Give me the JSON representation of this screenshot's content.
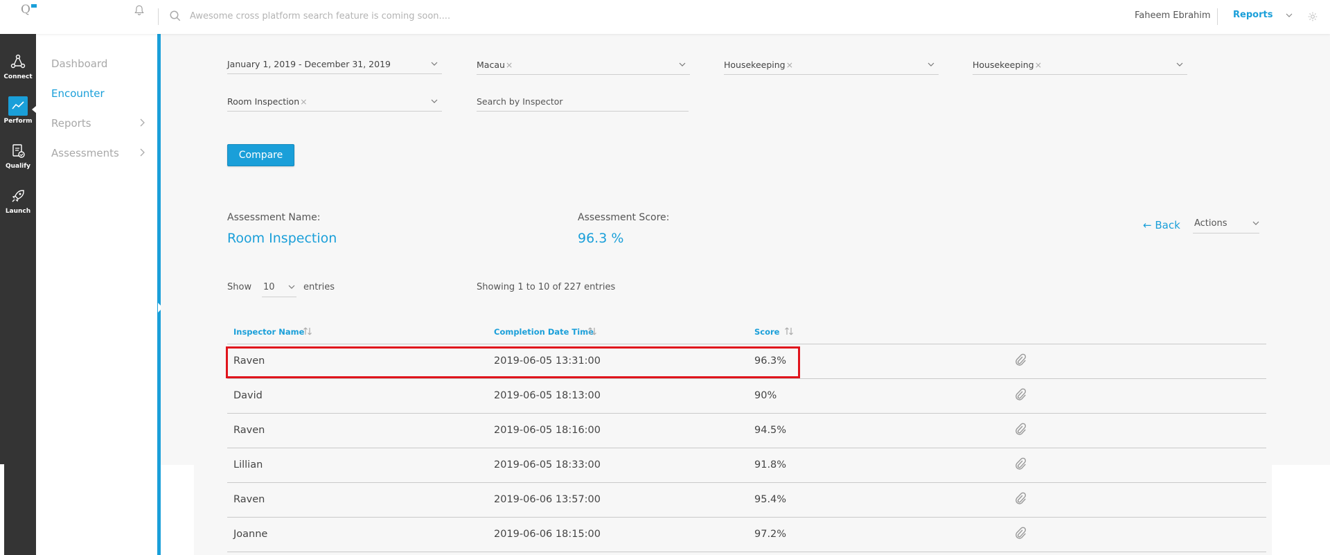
{
  "header": {
    "search_placeholder": "Awesome cross platform search feature is coming soon....",
    "user_name": "Faheem Ebrahim",
    "module_name": "Reports"
  },
  "rail": {
    "items": [
      {
        "label": "Connect",
        "icon": "connect-icon"
      },
      {
        "label": "Perform",
        "icon": "chart-line-icon",
        "active": true
      },
      {
        "label": "Qualify",
        "icon": "clipboard-check-icon"
      },
      {
        "label": "Launch",
        "icon": "rocket-icon"
      }
    ]
  },
  "subnav": {
    "items": [
      {
        "label": "Dashboard"
      },
      {
        "label": "Encounter",
        "active": true
      },
      {
        "label": "Reports"
      },
      {
        "label": "Assessments"
      }
    ]
  },
  "filters": {
    "date_range": "January 1, 2019 - December 31, 2019",
    "location": "Macau",
    "department_1": "Housekeeping",
    "department_2": "Housekeeping",
    "assessment": "Room Inspection",
    "inspector_placeholder": "Search by Inspector",
    "clear_symbol": "×"
  },
  "compare_button": "Compare",
  "summary": {
    "name_label": "Assessment Name:",
    "name_value": "Room Inspection",
    "score_label": "Assessment Score:",
    "score_value": "96.3 %",
    "back_label": "← Back",
    "actions_label": "Actions"
  },
  "table_controls": {
    "show_label": "Show",
    "page_length": "10",
    "entries_label": "entries",
    "info": "Showing 1 to 10 of 227 entries"
  },
  "table": {
    "columns": [
      "Inspector Name",
      "Completion Date Time",
      "Score"
    ],
    "rows": [
      {
        "name": "Raven",
        "datetime": "2019-06-05 13:31:00",
        "score": "96.3%"
      },
      {
        "name": "David",
        "datetime": "2019-06-05 18:13:00",
        "score": "90%"
      },
      {
        "name": "Raven",
        "datetime": "2019-06-05 18:16:00",
        "score": "94.5%"
      },
      {
        "name": "Lillian",
        "datetime": "2019-06-05 18:33:00",
        "score": "91.8%"
      },
      {
        "name": "Raven",
        "datetime": "2019-06-06 13:57:00",
        "score": "95.4%"
      },
      {
        "name": "Joanne",
        "datetime": "2019-06-06 18:15:00",
        "score": "97.2%"
      }
    ]
  },
  "colors": {
    "accent": "#1a9fd9",
    "rail": "#343434",
    "highlight": "#e0141c"
  }
}
